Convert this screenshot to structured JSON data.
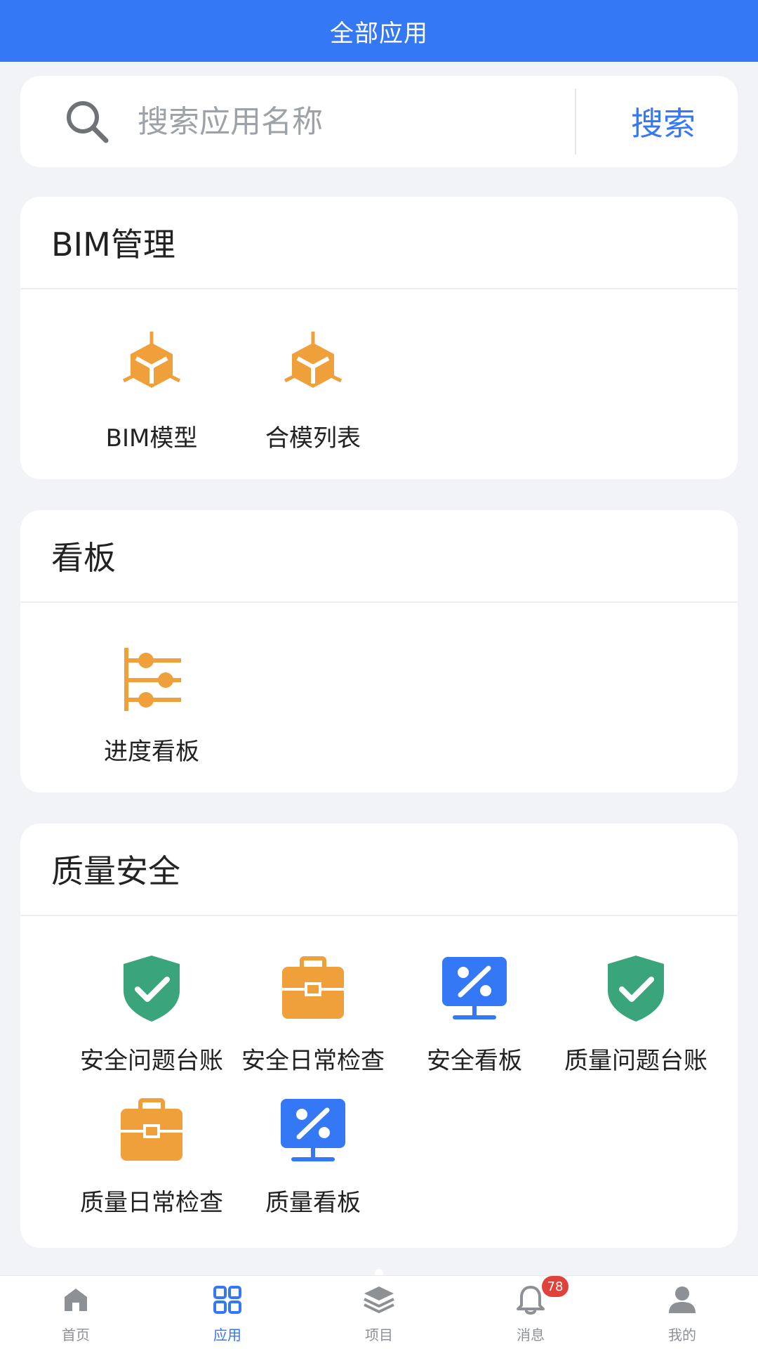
{
  "header": {
    "title": "全部应用"
  },
  "search": {
    "placeholder": "搜索应用名称",
    "value": "",
    "button_label": "搜索"
  },
  "sections": [
    {
      "title": "BIM管理",
      "items": [
        {
          "label": "BIM模型",
          "icon": "cube-icon"
        },
        {
          "label": "合模列表",
          "icon": "cube-icon"
        }
      ]
    },
    {
      "title": "看板",
      "items": [
        {
          "label": "进度看板",
          "icon": "progress-board-icon"
        }
      ]
    },
    {
      "title": "质量安全",
      "items": [
        {
          "label": "安全问题台账",
          "icon": "shield-check-icon"
        },
        {
          "label": "安全日常检查",
          "icon": "toolbox-icon"
        },
        {
          "label": "安全看板",
          "icon": "monitor-percent-icon"
        },
        {
          "label": "质量问题台账",
          "icon": "shield-check-icon"
        },
        {
          "label": "质量日常检查",
          "icon": "toolbox-icon"
        },
        {
          "label": "质量看板",
          "icon": "monitor-percent-icon"
        }
      ]
    }
  ],
  "tabbar": {
    "items": [
      {
        "label": "首页",
        "icon": "home-icon"
      },
      {
        "label": "应用",
        "icon": "apps-grid-icon",
        "active": true
      },
      {
        "label": "项目",
        "icon": "layers-icon"
      },
      {
        "label": "消息",
        "icon": "bell-icon",
        "badge": "78"
      },
      {
        "label": "我的",
        "icon": "user-icon"
      }
    ]
  },
  "colors": {
    "primary": "#3478f6",
    "orange": "#f0a03a",
    "green": "#3aa57a",
    "badge": "#e0413b"
  }
}
